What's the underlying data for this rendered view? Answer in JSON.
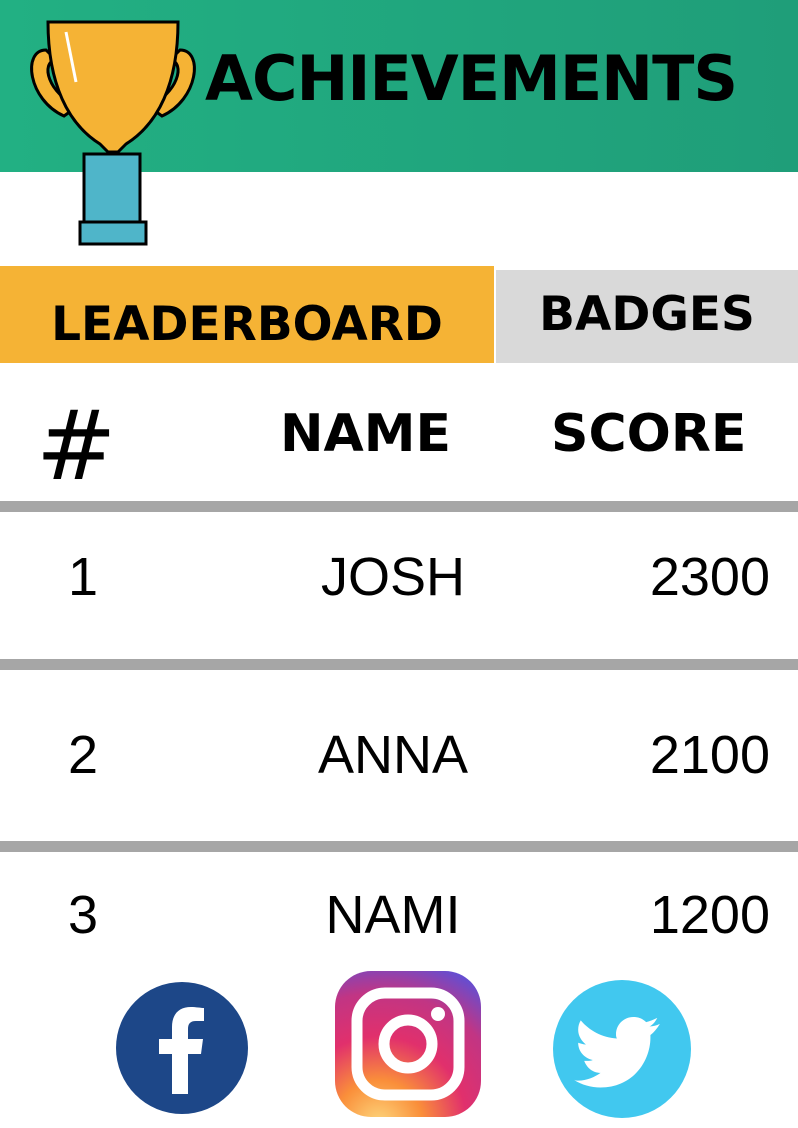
{
  "header": {
    "title": "ACHIEVEMENTS",
    "background_color": "#22b083"
  },
  "tabs": [
    {
      "label": "LEADERBOARD",
      "active": true,
      "color": "#f5b335"
    },
    {
      "label": "BADGES",
      "active": false,
      "color": "#d9d9d9"
    }
  ],
  "table": {
    "columns": [
      "#",
      "NAME",
      "SCORE"
    ],
    "rows": [
      {
        "rank": "1",
        "name": "JOSH",
        "score": "2300"
      },
      {
        "rank": "2",
        "name": "ANNA",
        "score": "2100"
      },
      {
        "rank": "3",
        "name": "NAMI",
        "score": "1200"
      }
    ]
  },
  "social": [
    {
      "icon": "facebook-icon",
      "color": "#1d4788"
    },
    {
      "icon": "instagram-icon",
      "color": "#d62976"
    },
    {
      "icon": "twitter-icon",
      "color": "#41c8ef"
    }
  ],
  "icons": {
    "trophy": "trophy-icon"
  }
}
